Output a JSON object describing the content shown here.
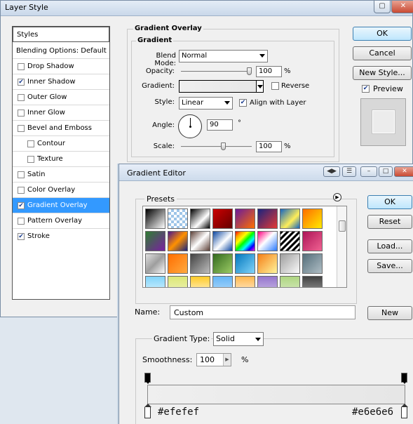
{
  "layer_style": {
    "title": "Layer Style",
    "styles_header": "Styles",
    "blending_options": "Blending Options: Default",
    "items": [
      {
        "label": "Drop Shadow",
        "checked": false
      },
      {
        "label": "Inner Shadow",
        "checked": true
      },
      {
        "label": "Outer Glow",
        "checked": false
      },
      {
        "label": "Inner Glow",
        "checked": false
      },
      {
        "label": "Bevel and Emboss",
        "checked": false
      },
      {
        "label": "Contour",
        "checked": false
      },
      {
        "label": "Texture",
        "checked": false
      },
      {
        "label": "Satin",
        "checked": false
      },
      {
        "label": "Color Overlay",
        "checked": false
      },
      {
        "label": "Gradient Overlay",
        "checked": true
      },
      {
        "label": "Pattern Overlay",
        "checked": false
      },
      {
        "label": "Stroke",
        "checked": true
      }
    ],
    "section_title": "Gradient Overlay",
    "subsection_title": "Gradient",
    "blend_mode_label": "Blend Mode:",
    "blend_mode_value": "Normal",
    "opacity_label": "Opacity:",
    "opacity_value": "100",
    "opacity_unit": "%",
    "gradient_label": "Gradient:",
    "reverse_label": "Reverse",
    "style_label": "Style:",
    "style_value": "Linear",
    "align_label": "Align with Layer",
    "angle_label": "Angle:",
    "angle_value": "90",
    "angle_unit": "°",
    "scale_label": "Scale:",
    "scale_value": "100",
    "scale_unit": "%",
    "ok_label": "OK",
    "cancel_label": "Cancel",
    "new_style_label": "New Style...",
    "preview_label": "Preview"
  },
  "gradient_editor": {
    "title": "Gradient Editor",
    "presets_label": "Presets",
    "ok_label": "OK",
    "reset_label": "Reset",
    "load_label": "Load...",
    "save_label": "Save...",
    "name_label": "Name:",
    "name_value": "Custom",
    "new_label": "New",
    "gradient_type_label": "Gradient Type:",
    "gradient_type_value": "Solid",
    "smoothness_label": "Smoothness:",
    "smoothness_value": "100",
    "smoothness_unit": "%",
    "start_color": "#efefef",
    "end_color": "#e6e6e6"
  },
  "colors": {
    "selection": "#3399ff",
    "default_button": "#bee6fd"
  }
}
